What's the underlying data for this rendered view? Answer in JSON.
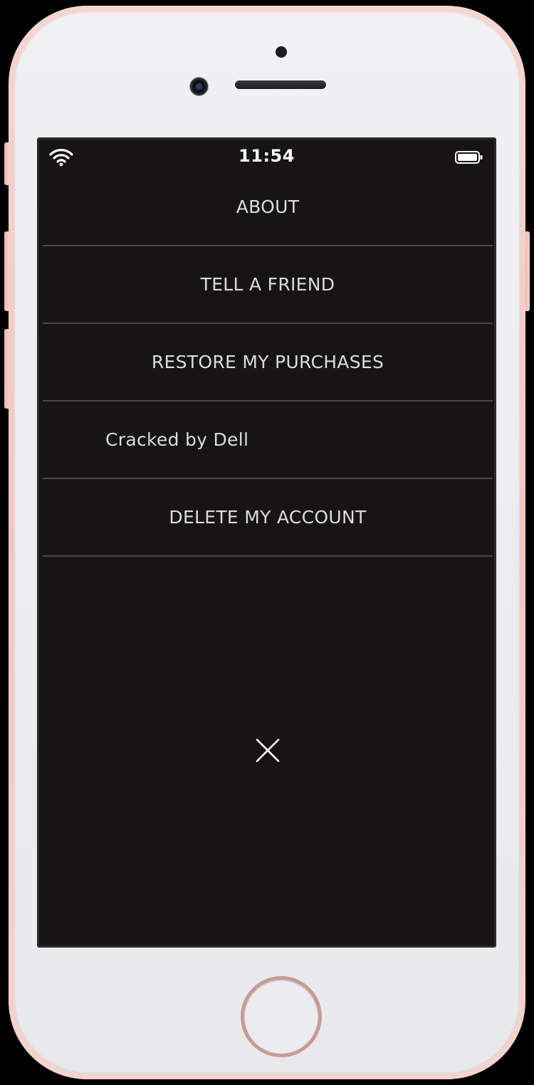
{
  "status_bar": {
    "time": "11:54",
    "wifi_icon": "wifi-icon",
    "battery_icon": "battery-icon"
  },
  "menu": {
    "items": [
      {
        "label": "ABOUT"
      },
      {
        "label": "TELL A FRIEND"
      },
      {
        "label": "RESTORE MY PURCHASES"
      },
      {
        "label": "Cracked by Dell"
      },
      {
        "label": "DELETE MY ACCOUNT"
      }
    ]
  },
  "close": {
    "icon": "close-icon"
  },
  "colors": {
    "screen_background": "#161514",
    "menu_text": "#dcdcdc",
    "divider": "#4a4a48",
    "phone_frame": "#efc7bf"
  }
}
